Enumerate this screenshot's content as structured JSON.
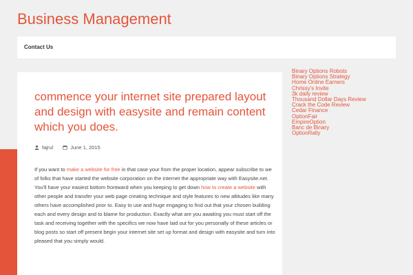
{
  "site": {
    "title": "Business Management"
  },
  "nav": {
    "items": [
      {
        "label": "Contact Us"
      }
    ]
  },
  "post": {
    "title": "commence your internet site prepared layout and design with easysite and remain content which you does.",
    "author": "fajrul",
    "date": "June 1, 2015",
    "content": {
      "t1": "If you want to ",
      "link1": "make a website for free",
      "t2": " in that case your from the proper location, appear subscribe to we of folks that have started the website corporation on the internet the appropriate way with Easysite.net. You'll have your easiest bottom frontward when you keeping to get down ",
      "link2": "how to create a website",
      "t3": " with other people and transfer your web page creating technique and style features to new altitudes like many others have accomplished prior to. Easy to use and huge engaging to find out that your chosen building each and every design and to blame for production. Exactly what are you awaiting you must start off the task and receiving together with the specifics we now have laid out for you personally of these articles or blog posts so start off present begin your internet site set up format and design with easysite and turn into pleased that you simply would."
    }
  },
  "sidebar": {
    "links": [
      "Binary Options Robots",
      "Binary Options Strategy",
      "Home Online Earners",
      "Chrissy's Invite",
      "3k daily review",
      "Thousand Dollar Days Review",
      "Crack the Code Review",
      "Cedar Finance",
      "OptionFair",
      "EmpireOption",
      "Banc de Binary",
      "OptionRally"
    ]
  },
  "colors": {
    "accent": "#e4543a",
    "background": "#f0f0f0",
    "panel": "#ffffff",
    "text": "#444444"
  },
  "icons": {
    "author": "user-icon",
    "date": "calendar-icon"
  }
}
